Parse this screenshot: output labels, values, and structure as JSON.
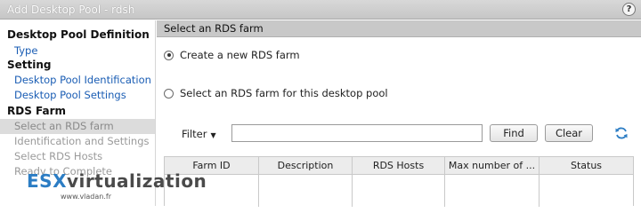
{
  "window": {
    "title": "Add Desktop Pool - rdsh",
    "help_label": "?"
  },
  "sidebar": {
    "section1": "Desktop Pool Definition",
    "item_type": "Type",
    "section2": "Setting",
    "item_identification": "Desktop Pool Identification",
    "item_settings": "Desktop Pool Settings",
    "section3": "RDS Farm",
    "item_current": "Select an RDS farm",
    "item_ident_settings": "Identification and Settings",
    "item_hosts": "Select RDS Hosts",
    "item_ready": "Ready to Complete"
  },
  "main": {
    "header": "Select an RDS farm",
    "radio_new": "Create a new RDS farm",
    "radio_existing": "Select an RDS farm for this desktop pool"
  },
  "filter": {
    "label": "Filter",
    "value": "",
    "find_label": "Find",
    "clear_label": "Clear"
  },
  "table": {
    "columns": [
      "Farm ID",
      "Description",
      "RDS Hosts",
      "Max number of ...",
      "Status"
    ]
  },
  "watermark": {
    "brand_prefix": "ES",
    "brand_mark": "X",
    "brand_rest": "virtualization",
    "url": "www.vladan.fr"
  },
  "colors": {
    "link": "#1a5db4",
    "header_bg": "#c8c8c8",
    "brand_blue": "#2c7dc4"
  }
}
